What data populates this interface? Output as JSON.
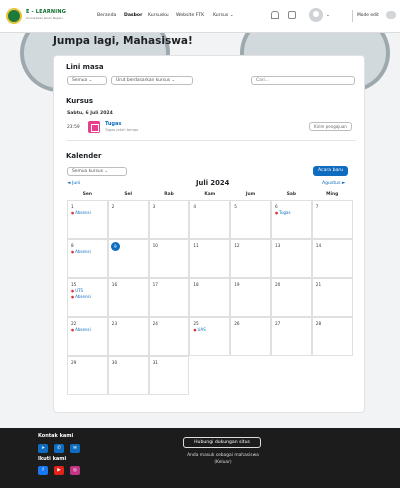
{
  "brand": {
    "name": "E - LEARNING",
    "subtitle": "Universitas Islam Negeri"
  },
  "nav": {
    "items": [
      {
        "label": "Beranda",
        "active": false
      },
      {
        "label": "Dasbor",
        "active": true
      },
      {
        "label": "Kursusku",
        "active": false
      },
      {
        "label": "Website FTK",
        "active": false
      },
      {
        "label": "Kursus ⌄",
        "active": false
      }
    ],
    "mode_label": "Mode edit"
  },
  "page_title": "Jumpa lagi, Mahasiswa!",
  "timeline": {
    "title": "Lini masa",
    "filter": "Semua ⌄",
    "sort": "Urut berdasarkan kursus ⌄",
    "search_placeholder": "Cari..."
  },
  "courses": {
    "title": "Kursus",
    "date": "Sabtu, 6 Juli 2024",
    "time": "23:59",
    "task_name": "Tugas",
    "task_sub": "Tugas jatuh tempo",
    "submit_label": "Kirim pengajuan"
  },
  "calendar": {
    "title": "Kalender",
    "course_select": "Semua kursus ⌄",
    "new_event": "Acara baru",
    "prev_month": "◄ Juni",
    "next_month": "Agustus ►",
    "month": "Juli 2024",
    "days": [
      "Sen",
      "Sel",
      "Rab",
      "Kam",
      "Jum",
      "Sab",
      "Ming"
    ],
    "weeks": [
      [
        {
          "d": "1",
          "e": [
            "Absensi"
          ]
        },
        {
          "d": "2",
          "e": []
        },
        {
          "d": "3",
          "e": []
        },
        {
          "d": "4",
          "e": []
        },
        {
          "d": "5",
          "e": []
        },
        {
          "d": "6",
          "e": [
            "Tugas"
          ]
        },
        {
          "d": "7",
          "e": []
        }
      ],
      [
        {
          "d": "8",
          "e": [
            "Absensi"
          ]
        },
        {
          "d": "9",
          "e": [],
          "today": true
        },
        {
          "d": "10",
          "e": []
        },
        {
          "d": "11",
          "e": []
        },
        {
          "d": "12",
          "e": []
        },
        {
          "d": "13",
          "e": []
        },
        {
          "d": "14",
          "e": []
        }
      ],
      [
        {
          "d": "15",
          "e": [
            "UTS",
            "Absensi"
          ]
        },
        {
          "d": "16",
          "e": []
        },
        {
          "d": "17",
          "e": []
        },
        {
          "d": "18",
          "e": []
        },
        {
          "d": "19",
          "e": []
        },
        {
          "d": "20",
          "e": []
        },
        {
          "d": "21",
          "e": []
        }
      ],
      [
        {
          "d": "22",
          "e": [
            "Absensi"
          ]
        },
        {
          "d": "23",
          "e": []
        },
        {
          "d": "24",
          "e": []
        },
        {
          "d": "25",
          "e": [
            "UAS"
          ]
        },
        {
          "d": "26",
          "e": []
        },
        {
          "d": "27",
          "e": []
        },
        {
          "d": "28",
          "e": []
        }
      ],
      [
        {
          "d": "29",
          "e": []
        },
        {
          "d": "30",
          "e": []
        },
        {
          "d": "31",
          "e": []
        }
      ]
    ]
  },
  "footer": {
    "contact_title": "Kontak kami",
    "follow_title": "Ikuti kami",
    "support_label": "Hubungi dukungan situs",
    "login_info": "Anda masuk sebagai mahasiswa",
    "logout": "(Keluar)"
  },
  "colors": {
    "primary": "#0f6cbf",
    "brand_green": "#0b6b2d",
    "event_dot": "#d63a3a",
    "footer_bg": "#1c1c1c"
  }
}
